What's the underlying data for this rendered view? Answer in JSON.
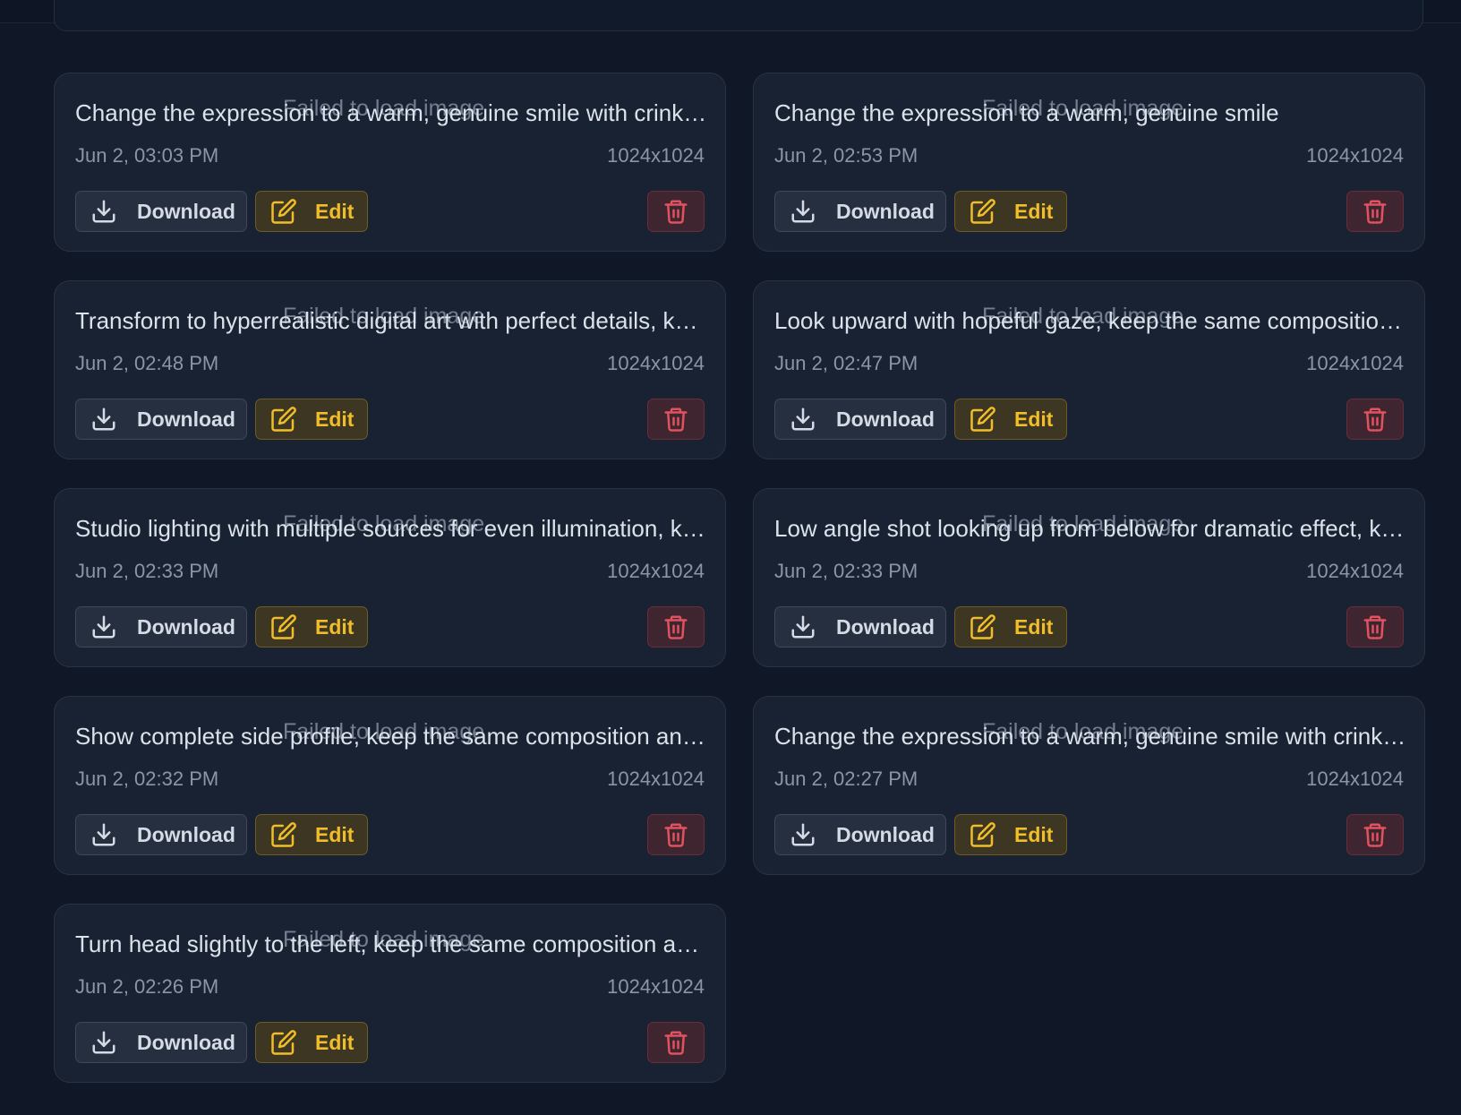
{
  "image_error_text": "Failed to load image",
  "buttons": {
    "download_label": "Download",
    "edit_label": "Edit"
  },
  "icons": {
    "download": "download-icon",
    "edit": "edit-icon",
    "delete": "trash-icon"
  },
  "colors": {
    "background": "#101828",
    "card": "#192232",
    "edit_accent": "#f1bd2a",
    "delete_accent": "#e0525e"
  },
  "images": [
    {
      "prompt": "Change the expression to a warm, genuine smile with crinkling eyes, keep the same composition and lighting",
      "date": "Jun 2, 03:03 PM",
      "size": "1024x1024"
    },
    {
      "prompt": "Change the expression to a warm, genuine smile",
      "date": "Jun 2, 02:53 PM",
      "size": "1024x1024"
    },
    {
      "prompt": "Transform to hyperrealistic digital art with perfect details, keep the same composition and lighting",
      "date": "Jun 2, 02:48 PM",
      "size": "1024x1024"
    },
    {
      "prompt": "Look upward with hopeful gaze, keep the same composition and lighting",
      "date": "Jun 2, 02:47 PM",
      "size": "1024x1024"
    },
    {
      "prompt": "Studio lighting with multiple sources for even illumination, keep the same composition",
      "date": "Jun 2, 02:33 PM",
      "size": "1024x1024"
    },
    {
      "prompt": "Low angle shot looking up from below for dramatic effect, keep the same composition",
      "date": "Jun 2, 02:33 PM",
      "size": "1024x1024"
    },
    {
      "prompt": "Show complete side profile, keep the same composition and lighting",
      "date": "Jun 2, 02:32 PM",
      "size": "1024x1024"
    },
    {
      "prompt": "Change the expression to a warm, genuine smile with crinkling eyes, keep the same composition and lighting",
      "date": "Jun 2, 02:27 PM",
      "size": "1024x1024"
    },
    {
      "prompt": "Turn head slightly to the left, keep the same composition and lighting",
      "date": "Jun 2, 02:26 PM",
      "size": "1024x1024"
    }
  ]
}
